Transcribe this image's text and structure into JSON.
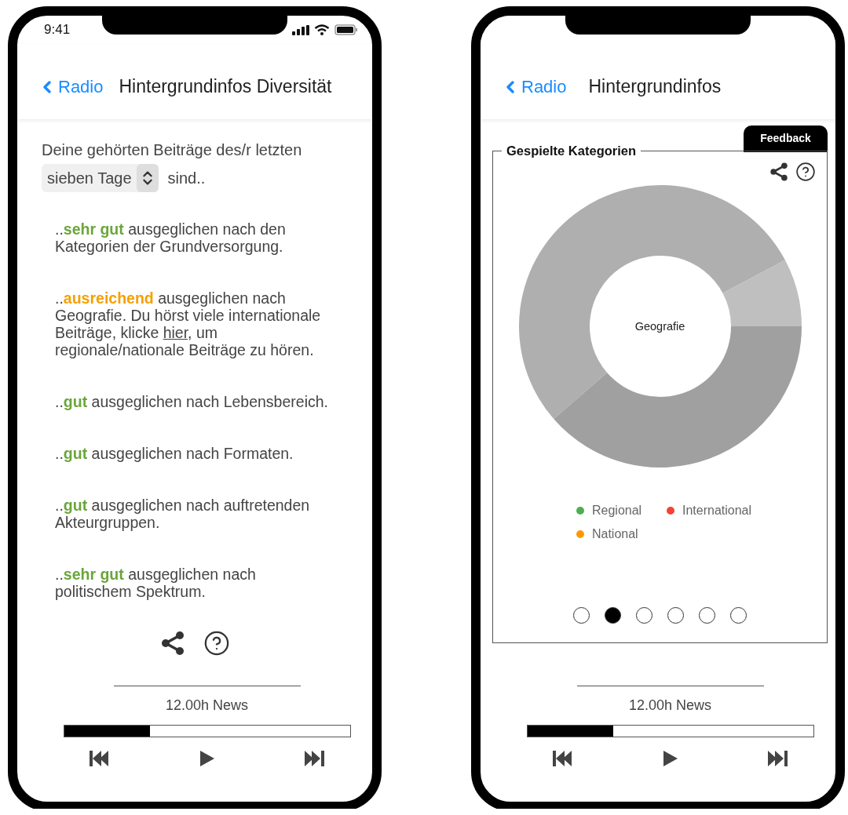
{
  "screens": [
    {
      "kind": "diversity",
      "status_bar": {
        "time": "9:41"
      },
      "nav": {
        "back": "Radio",
        "title": "Hintergrundinfos Diversität"
      },
      "intro": "Deine gehörten Beiträge des/r letzten",
      "period_select": {
        "value": "sieben Tage"
      },
      "intro_end": "sind..",
      "ratings": [
        {
          "prefix": "..",
          "rating": "sehr gut",
          "color": "#6aa63a",
          "text": "ausgeglichen nach den Kategorien der Grundversorgung."
        },
        {
          "prefix": "..",
          "rating": "ausreichend",
          "color": "#f5a000",
          "text": "ausgeglichen nach Geografie. Du hörst viele internationale Beiträge, klicke",
          "link": "hier",
          "text_after": ", um regionale/nationale Beiträge zu hören."
        },
        {
          "prefix": "..",
          "rating": "gut",
          "color": "#6aa63a",
          "text": "ausgeglichen nach Lebensbereich."
        },
        {
          "prefix": "..",
          "rating": "gut",
          "color": "#6aa63a",
          "text": "ausgeglichen nach Formaten."
        },
        {
          "prefix": "..",
          "rating": "gut",
          "color": "#6aa63a",
          "text": "ausgeglichen nach auftretenden Akteurgruppen."
        },
        {
          "prefix": "..",
          "rating": "sehr gut",
          "color": "#6aa63a",
          "text": "ausgeglichen nach politischem Spektrum."
        }
      ],
      "player": {
        "title": "12.00h News",
        "level": 0.3
      }
    },
    {
      "kind": "categories",
      "nav": {
        "back": "Radio",
        "title": "Hintergrundinfos"
      },
      "feedback": "Feedback",
      "card": {
        "title": "Gespielte Kategorien",
        "center_label": "Geografie",
        "legend": [
          {
            "label": "Regional",
            "color": "#4caf50"
          },
          {
            "label": "International",
            "color": "#f44336"
          },
          {
            "label": "National",
            "color": "#ff9800"
          }
        ],
        "pages": [
          {
            "selected": false
          },
          {
            "selected": true
          },
          {
            "selected": false
          },
          {
            "selected": false
          },
          {
            "selected": false
          },
          {
            "selected": false
          }
        ]
      },
      "player": {
        "title": "12.00h News",
        "level": 0.3
      }
    }
  ]
}
